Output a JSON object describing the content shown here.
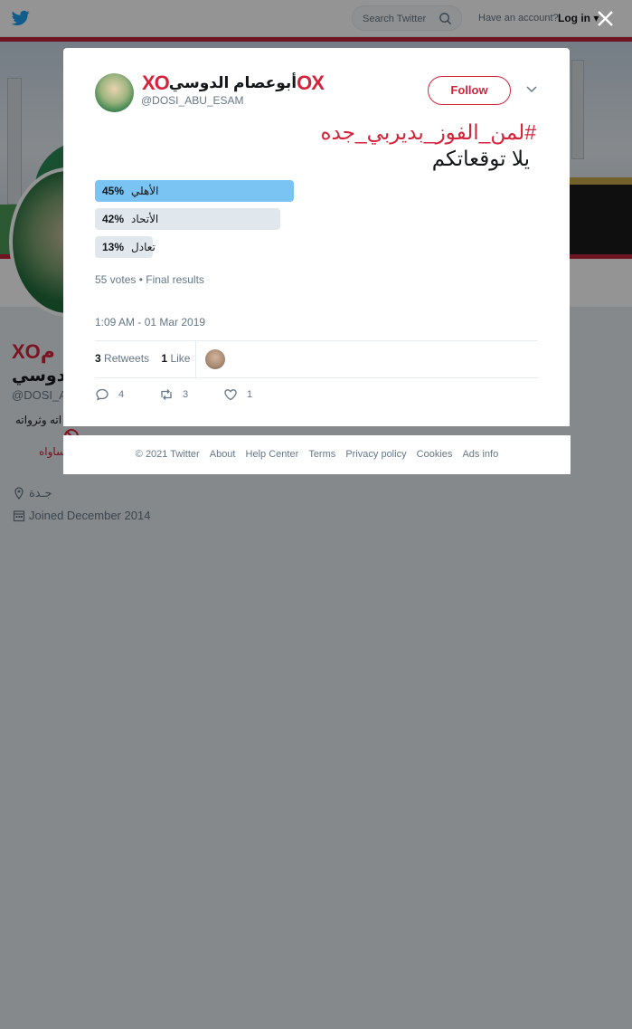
{
  "topbar": {
    "search_placeholder": "Search Twitter",
    "have_account": "Have an account?",
    "login": "Log in"
  },
  "profile": {
    "name_line1": "XOم",
    "name_line2": "الدوسي",
    "handle": "@DOSI_A",
    "bio_line": "اته وثرواته",
    "bio_red": "ساواه",
    "location": "جـدة",
    "joined": "Joined December 2014"
  },
  "tweet": {
    "display_name": "أبوعصام الدوسي",
    "handle": "@DOSI_ABU_ESAM",
    "follow_label": "Follow",
    "hashtag_line": "#لمن_الفوز_بديربي_جده",
    "text_line": "يلا توقعاتكم",
    "poll": [
      {
        "pct": "45%",
        "label": "الأهلي",
        "value": 45,
        "winner": true
      },
      {
        "pct": "42%",
        "label": "الأتحاد",
        "value": 42,
        "winner": false
      },
      {
        "pct": "13%",
        "label": "تعادل",
        "value": 13,
        "winner": false
      }
    ],
    "poll_meta": "55 votes • Final results",
    "timestamp": "1:09 AM - 01 Mar 2019",
    "retweets_count": "3",
    "retweets_label": "Retweets",
    "likes_count": "1",
    "likes_label": "Like",
    "actions": {
      "replies": "4",
      "retweets": "3",
      "likes": "1"
    }
  },
  "footer": {
    "copyright": "© 2021 Twitter",
    "links": [
      "About",
      "Help Center",
      "Terms",
      "Privacy policy",
      "Cookies",
      "Ads info"
    ]
  },
  "colors": {
    "brand_red": "#d4243c",
    "link_blue": "#1da1f2",
    "poll_winner": "#79c4f2"
  }
}
